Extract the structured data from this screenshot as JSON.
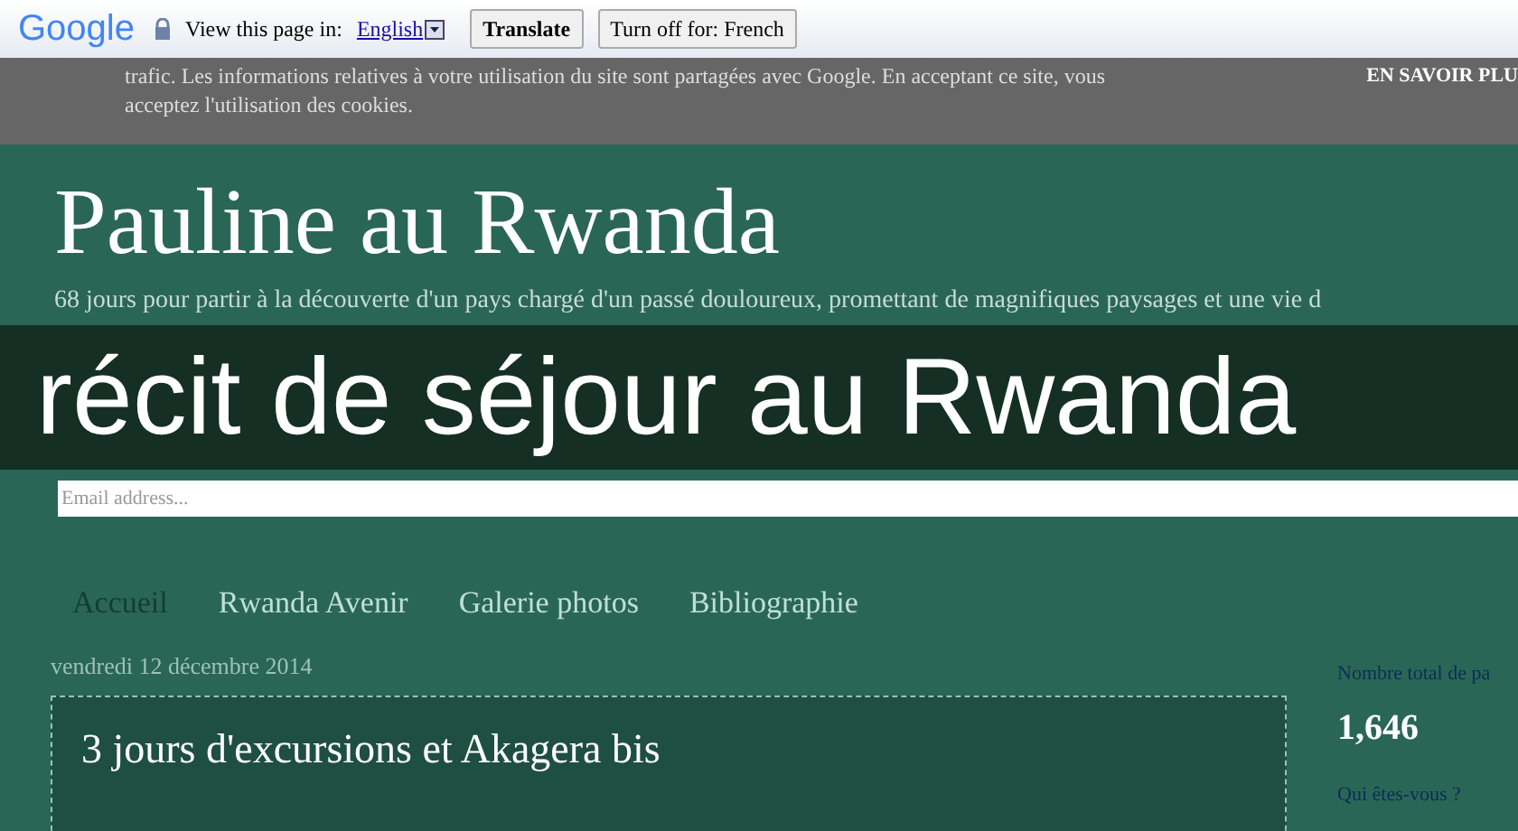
{
  "translate_bar": {
    "logo": "Google",
    "prompt": "View this page in:",
    "language": "English",
    "buttons": [
      "Translate",
      "Turn off for: French"
    ]
  },
  "cookie_notice": {
    "lines": [
      "trafic. Les informations relatives à votre utilisation du site sont partagées avec Google. En acceptant ce site, vous",
      "acceptez l'utilisation des cookies."
    ],
    "link": "EN SAVOIR PLU"
  },
  "blog": {
    "title": "Pauline au Rwanda",
    "description": "68 jours pour partir à la découverte d'un pays chargé d'un passé douloureux, promettant de magnifiques paysages et une vie d"
  },
  "overlay_title": "récit de séjour au Rwanda",
  "email_field": {
    "placeholder": "Email address..."
  },
  "nav": [
    {
      "label": "Accueil",
      "selected": true
    },
    {
      "label": "Rwanda Avenir",
      "selected": false
    },
    {
      "label": "Galerie photos",
      "selected": false
    },
    {
      "label": "Bibliographie",
      "selected": false
    }
  ],
  "post": {
    "date": "vendredi 12 décembre 2014",
    "title": "3 jours d'excursions et Akagera bis"
  },
  "sidebar": {
    "stats_heading": "Nombre total de pa",
    "stats_value": "1,646",
    "about_heading": "Qui êtes-vous ?"
  }
}
